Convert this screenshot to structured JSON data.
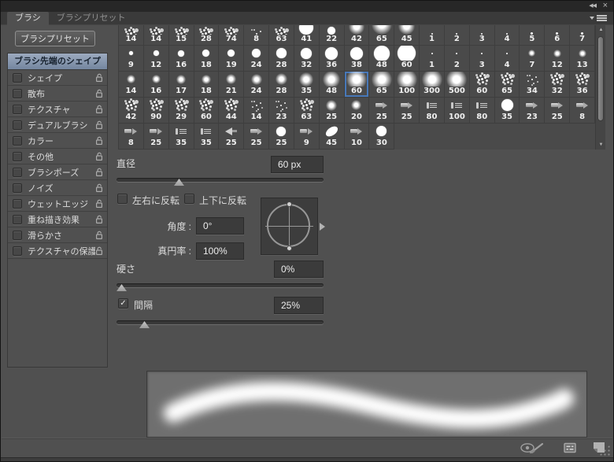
{
  "titlebar": {
    "collapse_icon": "◀◀",
    "close_icon": "×"
  },
  "icons": {
    "scroll_up": "▲",
    "scroll_down": "▼",
    "check": "✓",
    "bottom_bar": [
      "brush-stroke-preview-toggle",
      "open-preset-manager",
      "create-new-brush",
      "resize-grip"
    ]
  },
  "tabs": [
    {
      "label": "ブラシ",
      "active": true
    },
    {
      "label": "ブラシプリセット",
      "active": false
    }
  ],
  "preset_button": "ブラシプリセット",
  "sidebar": {
    "selected": "ブラシ先端のシェイプ",
    "items": [
      "シェイプ",
      "散布",
      "テクスチャ",
      "デュアルブラシ",
      "カラー",
      "その他",
      "ブラシポーズ",
      "ノイズ",
      "ウェットエッジ",
      "重ね描き効果",
      "滑らかさ",
      "テクスチャの保護"
    ]
  },
  "grid": {
    "selected_value": 60,
    "rows": [
      [
        {
          "v": 14,
          "t": "splat"
        },
        {
          "v": 14,
          "t": "splat"
        },
        {
          "v": 15,
          "t": "splat"
        },
        {
          "v": 28,
          "t": "splat"
        },
        {
          "v": 74,
          "t": "splat"
        },
        {
          "v": 8,
          "t": "spark"
        },
        {
          "v": 63,
          "t": "splat"
        },
        {
          "v": 41,
          "t": "hard"
        },
        {
          "v": 22,
          "t": "hard"
        },
        {
          "v": 42,
          "t": "soft"
        },
        {
          "v": 65,
          "t": "soft"
        },
        {
          "v": 45,
          "t": "soft"
        },
        {
          "v": 1,
          "t": "dot"
        },
        {
          "v": 2,
          "t": "dot"
        },
        {
          "v": 3,
          "t": "dot"
        },
        {
          "v": 4,
          "t": "dot"
        },
        {
          "v": 5,
          "t": "dot"
        },
        {
          "v": 6,
          "t": "dot"
        },
        {
          "v": 7,
          "t": "dot"
        }
      ],
      [
        {
          "v": 9,
          "t": "hard"
        },
        {
          "v": 12,
          "t": "hard"
        },
        {
          "v": 16,
          "t": "hard"
        },
        {
          "v": 18,
          "t": "hard"
        },
        {
          "v": 19,
          "t": "hard"
        },
        {
          "v": 24,
          "t": "hard"
        },
        {
          "v": 28,
          "t": "hard"
        },
        {
          "v": 32,
          "t": "hard"
        },
        {
          "v": 36,
          "t": "hard"
        },
        {
          "v": 38,
          "t": "hard"
        },
        {
          "v": 48,
          "t": "hard"
        },
        {
          "v": 60,
          "t": "hard"
        },
        {
          "v": 1,
          "t": "dot"
        },
        {
          "v": 2,
          "t": "dot"
        },
        {
          "v": 3,
          "t": "dot"
        },
        {
          "v": 4,
          "t": "dot"
        },
        {
          "v": 7,
          "t": "soft"
        },
        {
          "v": 12,
          "t": "soft"
        },
        {
          "v": 13,
          "t": "soft"
        }
      ],
      [
        {
          "v": 14,
          "t": "soft"
        },
        {
          "v": 16,
          "t": "soft"
        },
        {
          "v": 17,
          "t": "soft"
        },
        {
          "v": 18,
          "t": "soft"
        },
        {
          "v": 21,
          "t": "soft"
        },
        {
          "v": 24,
          "t": "soft"
        },
        {
          "v": 28,
          "t": "soft"
        },
        {
          "v": 35,
          "t": "soft"
        },
        {
          "v": 48,
          "t": "soft"
        },
        {
          "v": 60,
          "t": "soft",
          "sel": true
        },
        {
          "v": 65,
          "t": "soft"
        },
        {
          "v": 100,
          "t": "soft"
        },
        {
          "v": 300,
          "t": "soft"
        },
        {
          "v": 500,
          "t": "soft"
        },
        {
          "v": 60,
          "t": "splat"
        },
        {
          "v": 65,
          "t": "splat"
        },
        {
          "v": 34,
          "t": "spark"
        },
        {
          "v": 32,
          "t": "splat"
        },
        {
          "v": 36,
          "t": "splat"
        }
      ],
      [
        {
          "v": 42,
          "t": "splat"
        },
        {
          "v": 90,
          "t": "splat"
        },
        {
          "v": 29,
          "t": "splat"
        },
        {
          "v": 60,
          "t": "splat"
        },
        {
          "v": 44,
          "t": "splat"
        },
        {
          "v": 14,
          "t": "spark"
        },
        {
          "v": 23,
          "t": "spark"
        },
        {
          "v": 63,
          "t": "splat"
        },
        {
          "v": 25,
          "t": "soft"
        },
        {
          "v": 20,
          "t": "soft"
        },
        {
          "v": 25,
          "t": "nozzle"
        },
        {
          "v": 25,
          "t": "nozzle"
        },
        {
          "v": 80,
          "t": "flat"
        },
        {
          "v": 100,
          "t": "flat"
        },
        {
          "v": 80,
          "t": "flat"
        },
        {
          "v": 35,
          "t": "hard"
        },
        {
          "v": 23,
          "t": "nozzle"
        },
        {
          "v": 25,
          "t": "nozzle"
        },
        {
          "v": 8,
          "t": "nozzle"
        }
      ],
      [
        {
          "v": 8,
          "t": "nozzle"
        },
        {
          "v": 25,
          "t": "nozzle"
        },
        {
          "v": 35,
          "t": "flat"
        },
        {
          "v": 35,
          "t": "flat"
        },
        {
          "v": 25,
          "t": "fan"
        },
        {
          "v": 25,
          "t": "nozzle"
        },
        {
          "v": 25,
          "t": "hard"
        },
        {
          "v": 9,
          "t": "nozzle"
        },
        {
          "v": 45,
          "t": "oval"
        },
        {
          "v": 10,
          "t": "nozzle"
        },
        {
          "v": 30,
          "t": "hard"
        },
        null,
        null,
        null,
        null,
        null,
        null,
        null,
        null
      ]
    ]
  },
  "controls": {
    "diameter_label": "直径",
    "diameter_value": "60 px",
    "diameter_slider_pos": 0.29,
    "flip_x_label": "左右に反転",
    "flip_x_checked": false,
    "flip_y_label": "上下に反転",
    "flip_y_checked": false,
    "angle_label": "角度 :",
    "angle_value": "0°",
    "roundness_label": "真円率 :",
    "roundness_value": "100%",
    "hardness_label": "硬さ",
    "hardness_value": "0%",
    "hardness_slider_pos": 0.0,
    "spacing_label": "間隔",
    "spacing_checked": true,
    "spacing_value": "25%",
    "spacing_slider_pos": 0.115
  },
  "colors": {
    "panel_bg": "#505050",
    "grid_bg": "#4a4a4a",
    "selection_blue": "#4878b8",
    "sidebar_header_top": "#9caabf",
    "sidebar_header_bottom": "#74869f",
    "preview_bg": "#6f6f6f",
    "stroke": "#ffffff"
  }
}
